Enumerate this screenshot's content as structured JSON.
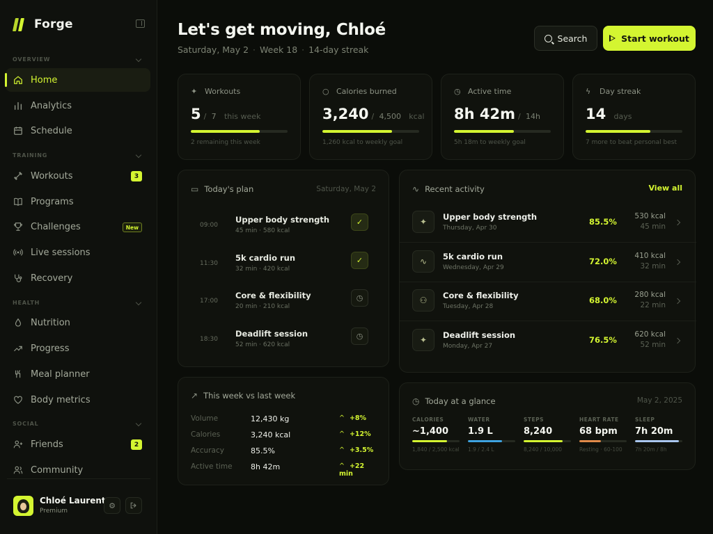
{
  "sidebar": {
    "brand": "Forge",
    "sections": [
      {
        "label": "OVERVIEW"
      },
      {
        "label": "TRAINING"
      },
      {
        "label": "HEALTH"
      },
      {
        "label": "SOCIAL"
      }
    ],
    "items": [
      {
        "label": "Home",
        "icon": "home-icon"
      },
      {
        "label": "Analytics",
        "icon": "bar-chart-icon"
      },
      {
        "label": "Schedule",
        "icon": "calendar-icon"
      },
      {
        "label": "Workouts",
        "icon": "dumbbell-icon",
        "badge": "3"
      },
      {
        "label": "Programs",
        "icon": "book-icon"
      },
      {
        "label": "Challenges",
        "icon": "trophy-icon",
        "badge": "New"
      },
      {
        "label": "Live sessions",
        "icon": "broadcast-icon"
      },
      {
        "label": "Recovery",
        "icon": "stethoscope-icon"
      },
      {
        "label": "Nutrition",
        "icon": "drop-icon"
      },
      {
        "label": "Progress",
        "icon": "trend-icon"
      },
      {
        "label": "Meal planner",
        "icon": "utensils-icon"
      },
      {
        "label": "Body metrics",
        "icon": "heart-icon"
      },
      {
        "label": "Friends",
        "icon": "user-plus-icon",
        "badge": "2"
      },
      {
        "label": "Community",
        "icon": "users-icon"
      }
    ],
    "user": {
      "name": "Chloé Laurent",
      "plan": "Premium"
    }
  },
  "header": {
    "title": "Let's get moving, Chloé",
    "date": "Saturday, May 2",
    "week": "Week 18",
    "streak": "14-day streak",
    "search_label": "Search",
    "start_label": "Start workout"
  },
  "stats": [
    {
      "label": "Workouts",
      "value": "5",
      "target": "7",
      "unit": "this week",
      "progress": 0.71,
      "note": "2 remaining this week"
    },
    {
      "label": "Calories burned",
      "value": "3,240",
      "target": "4,500",
      "unit": "kcal",
      "progress": 0.72,
      "note": "1,260 kcal to weekly goal"
    },
    {
      "label": "Active time",
      "value": "8h 42m",
      "target": "14h",
      "unit": "",
      "progress": 0.62,
      "note": "5h 18m to weekly goal"
    },
    {
      "label": "Day streak",
      "value": "14",
      "target": "",
      "unit": "days",
      "progress": 0.67,
      "note": "7 more to beat personal best"
    }
  ],
  "plan": {
    "title": "Today's plan",
    "date": "Saturday, May 2",
    "items": [
      {
        "time": "09:00",
        "name": "Upper body strength",
        "duration": "45 min",
        "kcal": "580 kcal",
        "done": true
      },
      {
        "time": "11:30",
        "name": "5k cardio run",
        "duration": "32 min",
        "kcal": "420 kcal",
        "done": true
      },
      {
        "time": "17:00",
        "name": "Core & flexibility",
        "duration": "20 min",
        "kcal": "210 kcal",
        "done": false
      },
      {
        "time": "18:30",
        "name": "Deadlift session",
        "duration": "52 min",
        "kcal": "620 kcal",
        "done": false
      }
    ]
  },
  "activity": {
    "title": "Recent activity",
    "view_all": "View all",
    "items": [
      {
        "name": "Upper body strength",
        "date": "Thursday, Apr 30",
        "pct": "85.5%",
        "kcal": "530 kcal",
        "duration": "45 min",
        "icon": "dumbbell-icon"
      },
      {
        "name": "5k cardio run",
        "date": "Wednesday, Apr 29",
        "pct": "72.0%",
        "kcal": "410 kcal",
        "duration": "32 min",
        "icon": "pulse-icon"
      },
      {
        "name": "Core & flexibility",
        "date": "Tuesday, Apr 28",
        "pct": "68.0%",
        "kcal": "280 kcal",
        "duration": "22 min",
        "icon": "users-icon"
      },
      {
        "name": "Deadlift session",
        "date": "Monday, Apr 27",
        "pct": "76.5%",
        "kcal": "620 kcal",
        "duration": "52 min",
        "icon": "dumbbell-icon"
      }
    ]
  },
  "compare": {
    "title": "This week vs last week",
    "rows": [
      {
        "label": "Volume",
        "value": "12,430 kg",
        "delta": "+8%"
      },
      {
        "label": "Calories",
        "value": "3,240 kcal",
        "delta": "+12%"
      },
      {
        "label": "Accuracy",
        "value": "85.5%",
        "delta": "+3.5%"
      },
      {
        "label": "Active time",
        "value": "8h 42m",
        "delta": "+22 min"
      }
    ]
  },
  "glance": {
    "title": "Today at a glance",
    "date": "May 2, 2025",
    "items": [
      {
        "label": "CALORIES",
        "value": "~1,400",
        "sub": "1,840 / 2,500 kcal",
        "progress": 0.74,
        "color": "#d4f531"
      },
      {
        "label": "WATER",
        "value": "1.9 L",
        "sub": "1.9 / 2.4 L",
        "progress": 0.72,
        "color": "#3ea3e0"
      },
      {
        "label": "STEPS",
        "value": "8,240",
        "sub": "8,240 / 10,000",
        "progress": 0.82,
        "color": "#d4f531"
      },
      {
        "label": "HEART RATE",
        "value": "68 bpm",
        "sub": "Resting · 60-100",
        "progress": 0.45,
        "color": "#e08a4a"
      },
      {
        "label": "SLEEP",
        "value": "7h 20m",
        "sub": "7h 20m / 8h",
        "progress": 0.92,
        "color": "#a9c6ee"
      }
    ]
  }
}
